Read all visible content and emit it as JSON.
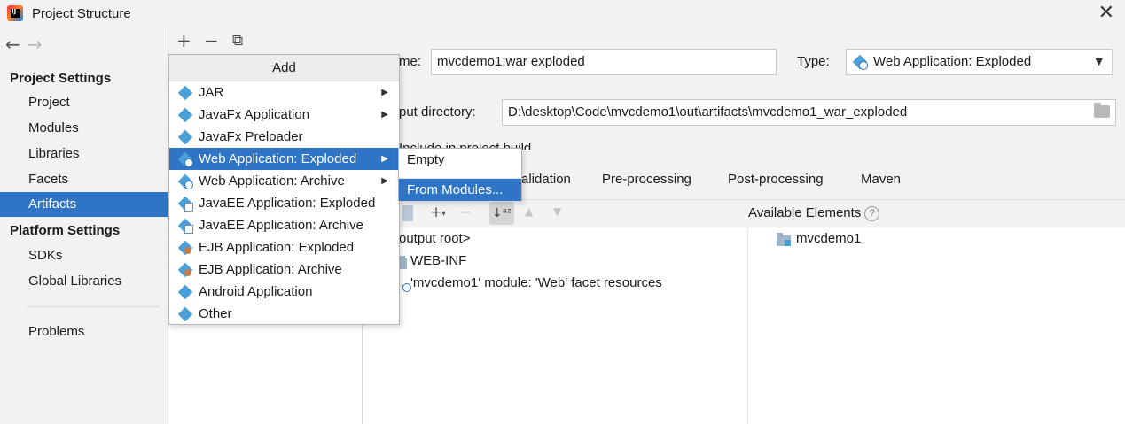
{
  "window": {
    "title": "Project Structure",
    "close_glyph": "✕"
  },
  "nav": {
    "back": "←",
    "forward": "→"
  },
  "sidebar": {
    "section1": "Project Settings",
    "items1": [
      {
        "label": "Project"
      },
      {
        "label": "Modules"
      },
      {
        "label": "Libraries"
      },
      {
        "label": "Facets"
      },
      {
        "label": "Artifacts",
        "selected": true
      }
    ],
    "section2": "Platform Settings",
    "items2": [
      {
        "label": "SDKs"
      },
      {
        "label": "Global Libraries"
      }
    ],
    "problems": "Problems"
  },
  "middle_toolbar": {
    "add": "+",
    "remove": "−",
    "copy": "⧉"
  },
  "artifact": {
    "name_label": "me:",
    "name_value": "mvcdemo1:war exploded",
    "type_label": "Type:",
    "type_value": "Web Application: Exploded",
    "output_label": "put directory:",
    "output_value": "D:\\desktop\\Code\\mvcdemo1\\out\\artifacts\\mvcdemo1_war_exploded",
    "include_label": "Include in project build"
  },
  "tabs": {
    "validation": "alidation",
    "preprocessing": "Pre-processing",
    "postprocessing": "Post-processing",
    "maven": "Maven"
  },
  "layout_toolbar": {
    "add": "+",
    "add_dropdown": "▾",
    "remove": "−",
    "sort": "↓ᵃᶻ",
    "up": "▲",
    "down": "▼",
    "available_label": "Available Elements",
    "help": "?"
  },
  "output_tree": [
    {
      "label": "output root>"
    },
    {
      "label": "WEB-INF"
    },
    {
      "label": "'mvcdemo1' module: 'Web' facet resources"
    }
  ],
  "available_tree": [
    {
      "label": "mvcdemo1"
    }
  ],
  "add_popup": {
    "header": "Add",
    "submenu_arrow": "▶",
    "items": [
      {
        "label": "JAR",
        "icon": "diamond-icon",
        "has_submenu": true
      },
      {
        "label": "JavaFx Application",
        "icon": "diamond-icon",
        "has_submenu": true
      },
      {
        "label": "JavaFx Preloader",
        "icon": "diamond-icon",
        "has_submenu": false
      },
      {
        "label": "Web Application: Exploded",
        "icon": "web-globe-icon",
        "has_submenu": true,
        "selected": true
      },
      {
        "label": "Web Application: Archive",
        "icon": "web-globe-icon",
        "has_submenu": true
      },
      {
        "label": "JavaEE Application: Exploded",
        "icon": "javaee-icon",
        "has_submenu": false
      },
      {
        "label": "JavaEE Application: Archive",
        "icon": "javaee-icon",
        "has_submenu": false
      },
      {
        "label": "EJB Application: Exploded",
        "icon": "ejb-icon",
        "has_submenu": false
      },
      {
        "label": "EJB Application: Archive",
        "icon": "ejb-icon",
        "has_submenu": false
      },
      {
        "label": "Android Application",
        "icon": "diamond-icon",
        "has_submenu": false
      },
      {
        "label": "Other",
        "icon": "diamond-icon",
        "has_submenu": false
      }
    ]
  },
  "submenu": {
    "items": [
      {
        "label": "Empty"
      },
      {
        "label": "From Modules...",
        "selected": true
      }
    ]
  },
  "colors": {
    "selection": "#2f74c5",
    "panel_bg": "#f2f2f2",
    "content_bg": "#ffffff"
  }
}
